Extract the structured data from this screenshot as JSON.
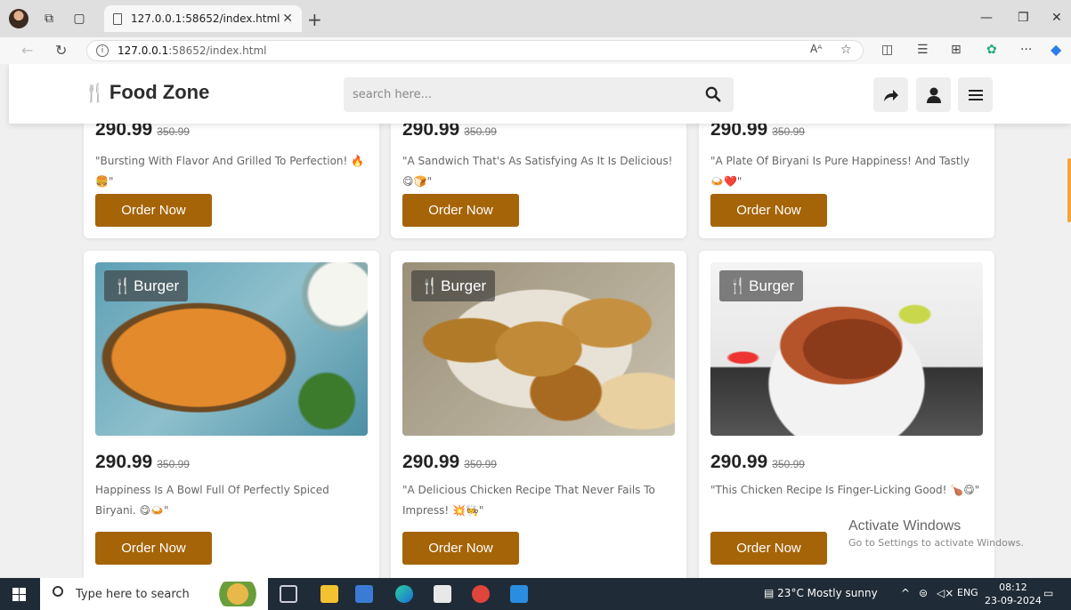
{
  "browser": {
    "tab_title": "127.0.0.1:58652/index.html",
    "url_host": "127.0.0.1",
    "url_path": ":58652/index.html"
  },
  "header": {
    "brand": "Food Zone",
    "search_placeholder": "search here..."
  },
  "partial_cards": [
    {
      "price": "290.99",
      "old_price": "350.99",
      "desc": "\"Bursting With Flavor And Grilled To Perfection! 🔥🍔\"",
      "button": "Order Now"
    },
    {
      "price": "290.99",
      "old_price": "350.99",
      "desc": "\"A Sandwich That's As Satisfying As It Is Delicious! 😋🍞\"",
      "button": "Order Now"
    },
    {
      "price": "290.99",
      "old_price": "350.99",
      "desc": "\"A Plate Of Biryani Is Pure Happiness! And Tastly🍛❤️\"",
      "button": "Order Now"
    }
  ],
  "cards": [
    {
      "badge": "Burger",
      "price": "290.99",
      "old_price": "350.99",
      "desc": "Happiness Is A Bowl Full Of Perfectly Spiced Biryani. 😋🍛\"",
      "button": "Order Now"
    },
    {
      "badge": "Burger",
      "price": "290.99",
      "old_price": "350.99",
      "desc": "\"A Delicious Chicken Recipe That Never Fails To Impress! 💥🧑‍🍳\"",
      "button": "Order Now"
    },
    {
      "badge": "Burger",
      "price": "290.99",
      "old_price": "350.99",
      "desc": "\"This Chicken Recipe Is Finger-Licking Good! 🍗😋\"",
      "button": "Order Now"
    }
  ],
  "watermark": {
    "line1": "Activate Windows",
    "line2": "Go to Settings to activate Windows."
  },
  "taskbar": {
    "search_text": "Type here to search",
    "weather": "23°C  Mostly sunny",
    "lang": "ENG",
    "time": "08:12",
    "date": "23-09-2024"
  }
}
